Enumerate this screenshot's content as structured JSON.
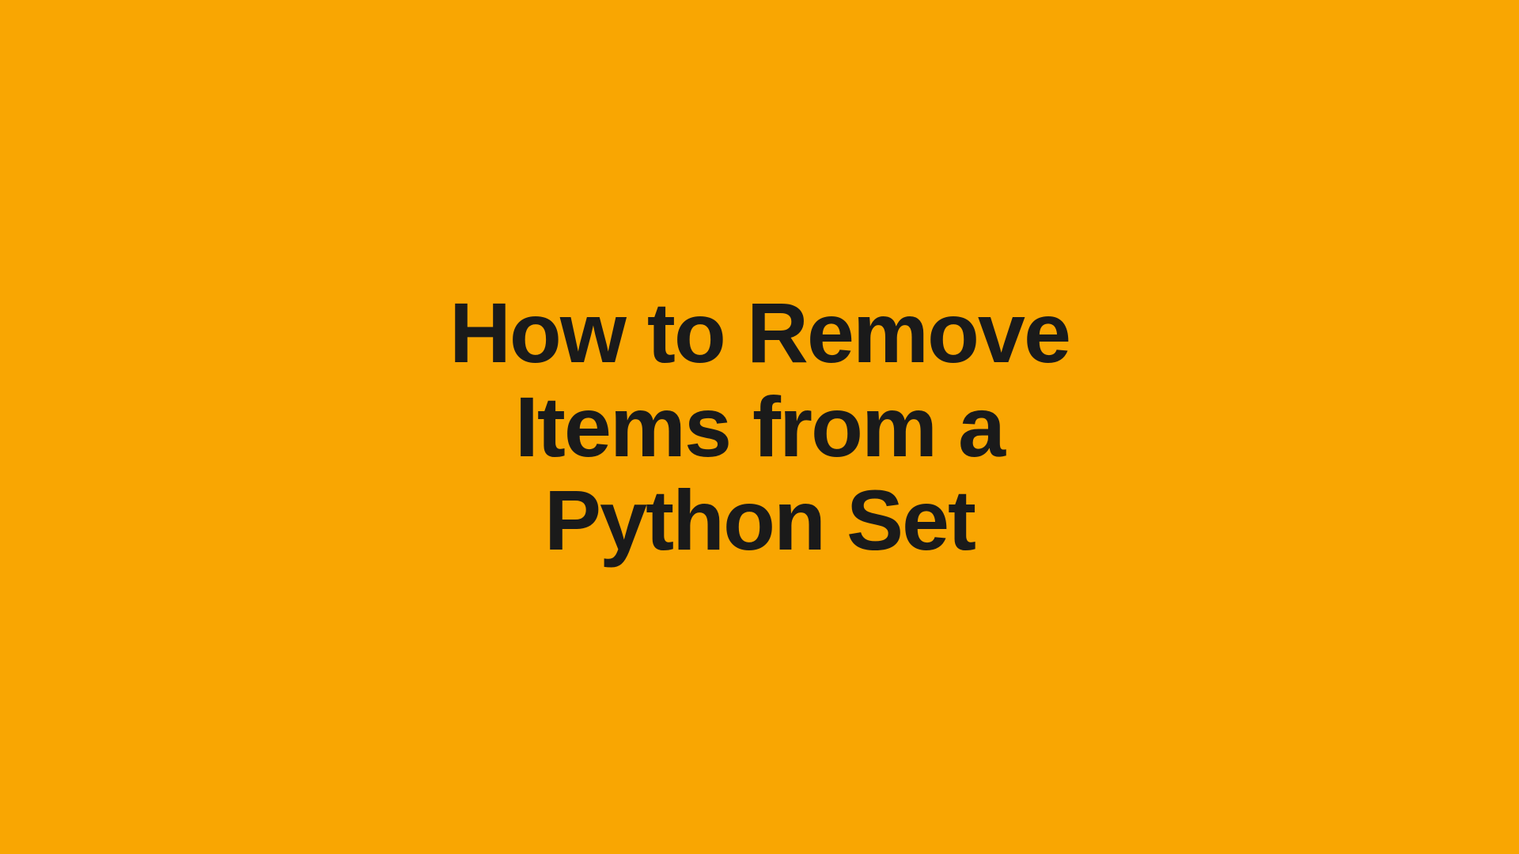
{
  "title": {
    "line1": "How to Remove",
    "line2": "Items from a",
    "line3": "Python Set"
  }
}
